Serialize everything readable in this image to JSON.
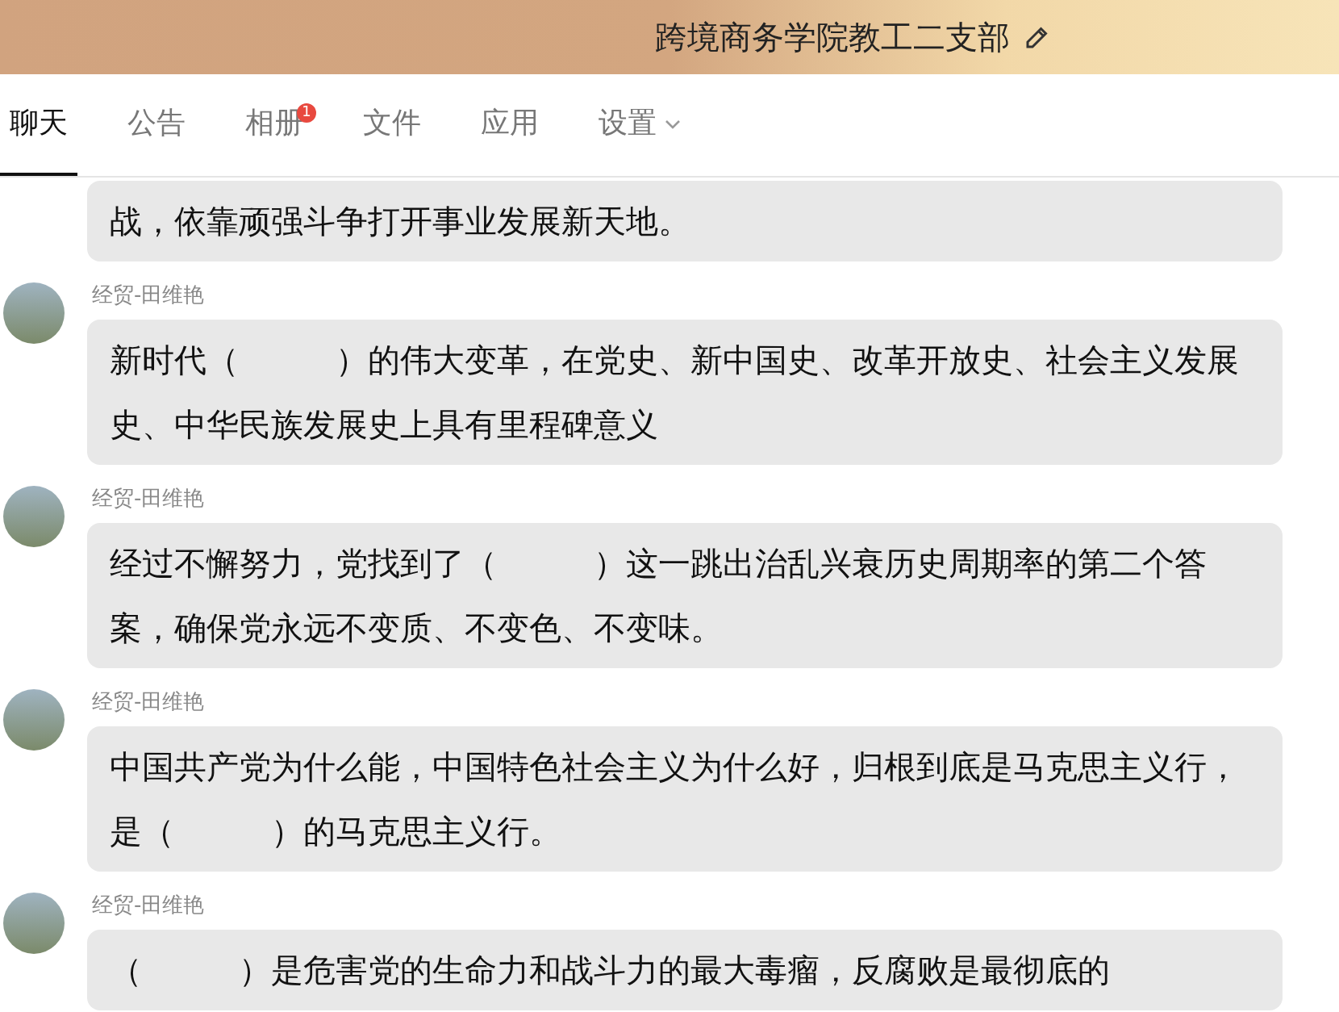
{
  "header": {
    "title": "跨境商务学院教工二支部"
  },
  "tabs": [
    {
      "label": "聊天",
      "selected": true
    },
    {
      "label": "公告",
      "selected": false
    },
    {
      "label": "相册",
      "selected": false,
      "badge": "1"
    },
    {
      "label": "文件",
      "selected": false
    },
    {
      "label": "应用",
      "selected": false
    },
    {
      "label": "设置",
      "selected": false,
      "dropdown": true
    }
  ],
  "messages": [
    {
      "text": "战，依靠顽强斗争打开事业发展新天地。"
    },
    {
      "sender": "经贸-田维艳",
      "text": "新时代（　　　）的伟大变革，在党史、新中国史、改革开放史、社会主义发展史、中华民族发展史上具有里程碑意义"
    },
    {
      "sender": "经贸-田维艳",
      "text": "经过不懈努力，党找到了（　　　）这一跳出治乱兴衰历史周期率的第二个答案，确保党永远不变质、不变色、不变味。"
    },
    {
      "sender": "经贸-田维艳",
      "text": "中国共产党为什么能，中国特色社会主义为什么好，归根到底是马克思主义行，是（　　　）的马克思主义行。"
    },
    {
      "sender": "经贸-田维艳",
      "text": "（　　　）是危害党的生命力和战斗力的最大毒瘤，反腐败是最彻底的"
    }
  ]
}
